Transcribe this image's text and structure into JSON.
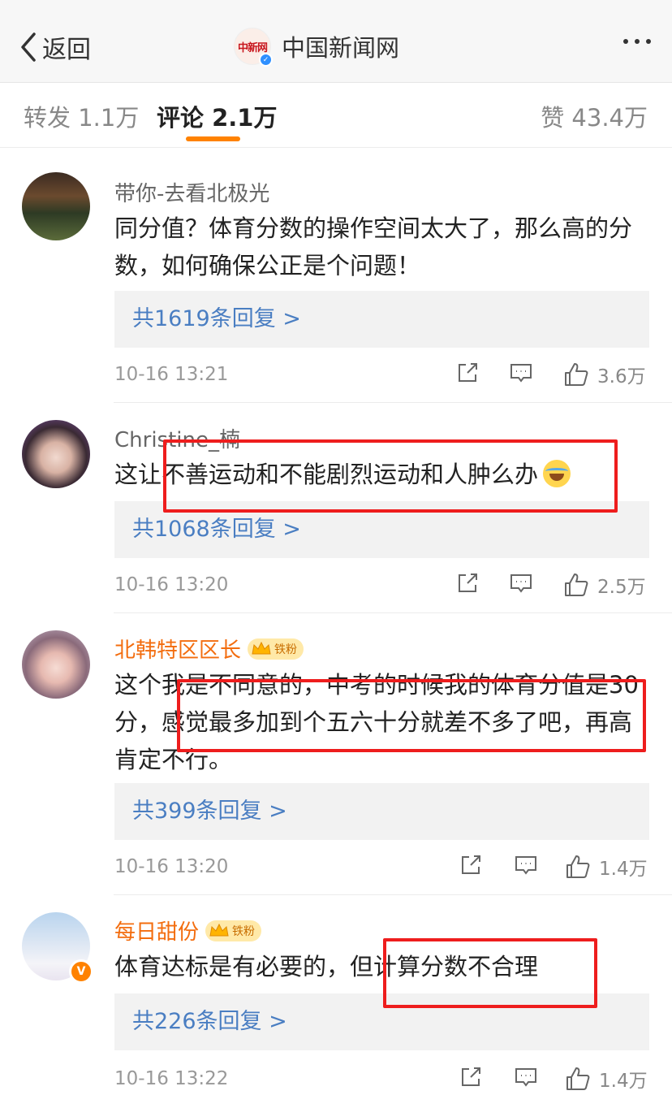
{
  "nav": {
    "back_label": "返回",
    "account_name": "中国新闻网",
    "logo_text": "中新网"
  },
  "tabs": {
    "repost": "转发 1.1万",
    "comment": "评论 2.1万",
    "like": "赞 43.4万"
  },
  "comments": [
    {
      "user": "带你-去看北极光",
      "vip": false,
      "fan_badge": "",
      "text": "同分值？体育分数的操作空间太大了，那么高的分数，如何确保公正是个问题！",
      "replies": "共1619条回复 >",
      "time": "10-16 13:21",
      "likes": "3.6万"
    },
    {
      "user": "Christine_楠",
      "vip": false,
      "fan_badge": "",
      "text": "这让不善运动和不能剧烈运动和人肿么办",
      "replies": "共1068条回复 >",
      "time": "10-16 13:20",
      "likes": "2.5万"
    },
    {
      "user": "北韩特区区长",
      "vip": true,
      "fan_badge": "铁粉",
      "text": "这个我是不同意的，中考的时候我的体育分值是30分，感觉最多加到个五六十分就差不多了吧，再高肯定不行。",
      "replies": "共399条回复 >",
      "time": "10-16 13:20",
      "likes": "1.4万"
    },
    {
      "user": "每日甜份",
      "vip": true,
      "fan_badge": "铁粉",
      "text": "体育达标是有必要的，但计算分数不合理",
      "replies": "共226条回复 >",
      "time": "10-16 13:22",
      "likes": "1.4万"
    }
  ],
  "colors": {
    "accent": "#ff8200",
    "link": "#4a7ec2",
    "highlight": "#ee1d1d",
    "vip_name": "#f36d0f"
  },
  "icons": [
    "chevron-left-icon",
    "verified-icon",
    "more-icon",
    "share-icon",
    "comment-icon",
    "like-icon",
    "crown-icon",
    "laugh-cry-emoji"
  ]
}
